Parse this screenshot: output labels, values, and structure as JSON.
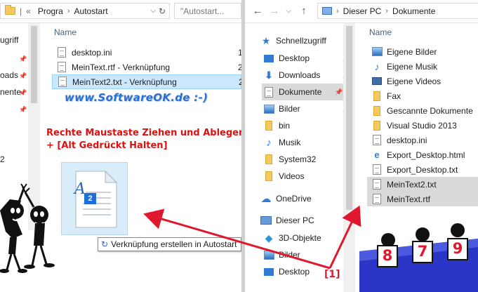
{
  "left": {
    "breadcrumb": {
      "overflow": "«",
      "part1": "Progra",
      "part2": "Autostart"
    },
    "search_placeholder": "\"Autostart...",
    "column_name": "Name",
    "files": [
      {
        "name": "desktop.ini",
        "extra": "1"
      },
      {
        "name": "MeinText.rtf - Verknüpfung",
        "extra": "2"
      },
      {
        "name": "MeinText2.txt - Verknüpfung",
        "extra": "2"
      }
    ],
    "nav_partial": [
      "ugriff",
      "oads",
      "nente",
      "2"
    ],
    "watermark": "www.SoftwareOK.de :-)",
    "instruction_line1": "Rechte Maustaste Ziehen und Ablegen",
    "instruction_line2": "+ [Alt Gedrückt Halten]",
    "drag_badge": "2",
    "drag_tooltip": "Verknüpfung erstellen in Autostart",
    "tooltip_arrow": "↻"
  },
  "right": {
    "breadcrumb": {
      "root": "Dieser PC",
      "current": "Dokumente"
    },
    "column_name": "Name",
    "nav": [
      {
        "label": "Schnellzugriff",
        "icon": "star-icon"
      },
      {
        "label": "Desktop",
        "icon": "desktop-icon",
        "pinned": true
      },
      {
        "label": "Downloads",
        "icon": "download-icon",
        "pinned": true
      },
      {
        "label": "Dokumente",
        "icon": "documents-icon",
        "pinned": true,
        "selected": true
      },
      {
        "label": "Bilder",
        "icon": "pictures-icon",
        "pinned": true
      },
      {
        "label": "bin",
        "icon": "folder-icon"
      },
      {
        "label": "Musik",
        "icon": "music-icon"
      },
      {
        "label": "System32",
        "icon": "folder-icon"
      },
      {
        "label": "Videos",
        "icon": "folder-icon"
      },
      {
        "label": "OneDrive",
        "icon": "onedrive-icon"
      },
      {
        "label": "Dieser PC",
        "icon": "computer-icon"
      },
      {
        "label": "3D-Objekte",
        "icon": "3d-objects-icon"
      },
      {
        "label": "Bilder",
        "icon": "pictures-icon"
      },
      {
        "label": "Desktop",
        "icon": "desktop-icon"
      }
    ],
    "files": [
      {
        "name": "Eigene Bilder",
        "icon": "shortcut-pictures-icon"
      },
      {
        "name": "Eigene Musik",
        "icon": "shortcut-music-icon"
      },
      {
        "name": "Eigene Videos",
        "icon": "shortcut-videos-icon"
      },
      {
        "name": "Fax",
        "icon": "folder-icon"
      },
      {
        "name": "Gescannte Dokumente",
        "icon": "folder-icon"
      },
      {
        "name": "Visual Studio 2013",
        "icon": "folder-icon"
      },
      {
        "name": "desktop.ini",
        "icon": "settings-file-icon"
      },
      {
        "name": "Export_Desktop.html",
        "icon": "html-file-icon"
      },
      {
        "name": "Export_Desktop.txt",
        "icon": "text-file-icon"
      },
      {
        "name": "MeinText2.txt",
        "icon": "text-file-icon",
        "selected": true
      },
      {
        "name": "MeinText.rtf",
        "icon": "text-file-icon",
        "selected": true
      }
    ]
  },
  "annotations": {
    "marker": "[1]",
    "scores": [
      "8",
      "7",
      "9"
    ]
  },
  "colors": {
    "arrow": "#e0182d",
    "watermark": "#2b6fd0",
    "instruction": "#e01010",
    "selection": "#cce8ff",
    "jury_table": "#2b36c8"
  }
}
